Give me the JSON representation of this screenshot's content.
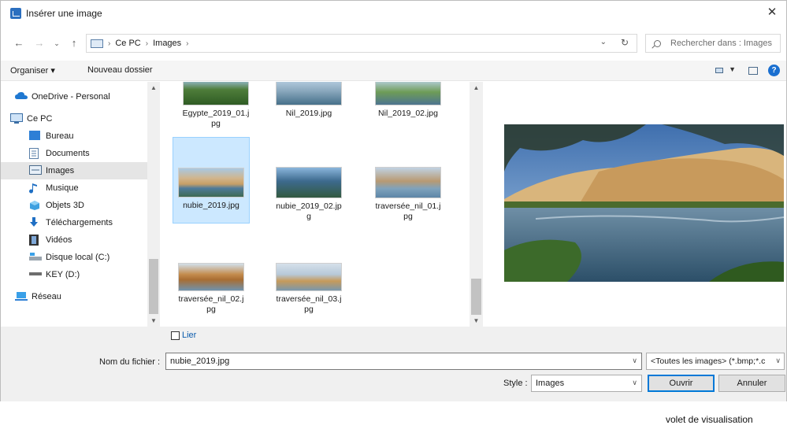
{
  "window": {
    "title": "Insérer une image"
  },
  "nav": {
    "breadcrumb": [
      "Ce PC",
      "Images"
    ],
    "search_placeholder": "Rechercher dans : Images"
  },
  "toolbar": {
    "organise_label": "Organiser ▾",
    "new_folder_label": "Nouveau dossier"
  },
  "sidebar": {
    "items": [
      {
        "label": "OneDrive - Personal",
        "icon": "cloud-icon"
      },
      {
        "label": "Ce PC",
        "icon": "computer-icon"
      },
      {
        "label": "Bureau",
        "icon": "desktop-icon"
      },
      {
        "label": "Documents",
        "icon": "documents-icon"
      },
      {
        "label": "Images",
        "icon": "pictures-icon",
        "selected": true
      },
      {
        "label": "Musique",
        "icon": "music-icon"
      },
      {
        "label": "Objets 3D",
        "icon": "objects-3d-icon"
      },
      {
        "label": "Téléchargements",
        "icon": "downloads-icon"
      },
      {
        "label": "Vidéos",
        "icon": "videos-icon"
      },
      {
        "label": "Disque local (C:)",
        "icon": "drive-icon"
      },
      {
        "label": "KEY (D:)",
        "icon": "usb-drive-icon"
      },
      {
        "label": "Réseau",
        "icon": "network-icon"
      }
    ]
  },
  "files": [
    {
      "name": "Egypte_2019_01.jpg",
      "label_lines": [
        "Egypte_2019_01.j",
        "pg"
      ]
    },
    {
      "name": "Nil_2019.jpg",
      "label_lines": [
        "Nil_2019.jpg"
      ]
    },
    {
      "name": "Nil_2019_02.jpg",
      "label_lines": [
        "Nil_2019_02.jpg"
      ]
    },
    {
      "name": "nubie_2019.jpg",
      "label_lines": [
        "nubie_2019.jpg"
      ],
      "selected": true
    },
    {
      "name": "nubie_2019_02.jpg",
      "label_lines": [
        "nubie_2019_02.jp",
        "g"
      ]
    },
    {
      "name": "traversée_nil_01.jpg",
      "label_lines": [
        "traversée_nil_01.j",
        "pg"
      ]
    },
    {
      "name": "traversée_nil_02.jpg",
      "label_lines": [
        "traversée_nil_02.j",
        "pg"
      ]
    },
    {
      "name": "traversée_nil_03.jpg",
      "label_lines": [
        "traversée_nil_03.j",
        "pg"
      ]
    }
  ],
  "bottom": {
    "link_label": "Lier",
    "filename_label": "Nom du fichier :",
    "filename_value": "nubie_2019.jpg",
    "filetype_value": "<Toutes les images> (*.bmp;*.c",
    "style_label": "Style :",
    "style_value": "Images",
    "open_label": "Ouvrir",
    "cancel_label": "Annuler"
  },
  "caption": "volet de visualisation"
}
